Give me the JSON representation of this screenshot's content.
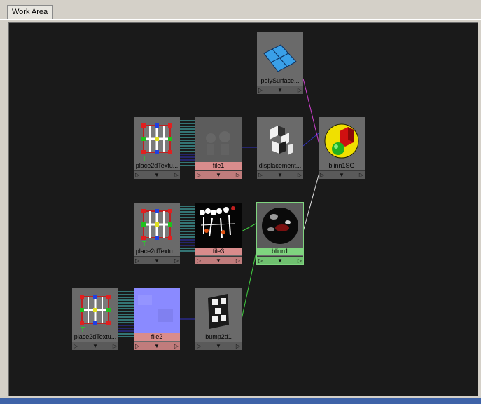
{
  "tab": {
    "label": "Work Area"
  },
  "nodes": {
    "poly": {
      "label": "polySurface..."
    },
    "place1": {
      "label": "place2dTextu..."
    },
    "file1": {
      "label": "file1"
    },
    "disp": {
      "label": "displacement..."
    },
    "blinnsg": {
      "label": "blinn1SG"
    },
    "place2": {
      "label": "place2dTextu..."
    },
    "file3": {
      "label": "file3"
    },
    "blinn1": {
      "label": "blinn1"
    },
    "place3": {
      "label": "place2dTextu..."
    },
    "file2": {
      "label": "file2"
    },
    "bump": {
      "label": "bump2d1"
    }
  },
  "controls": {
    "left": "▷",
    "mid": "▼",
    "right": "▷"
  },
  "colors": {
    "canvas": "#1a1a1a",
    "node": "#6a6a6a",
    "file_node": "#d98c8c",
    "selected_node": "#7fd47f",
    "conn_cyan": "#4fd0d0",
    "conn_blue": "#3030c0",
    "conn_magenta": "#d040d0",
    "conn_white": "#e0e0e0",
    "conn_green": "#40d040"
  }
}
